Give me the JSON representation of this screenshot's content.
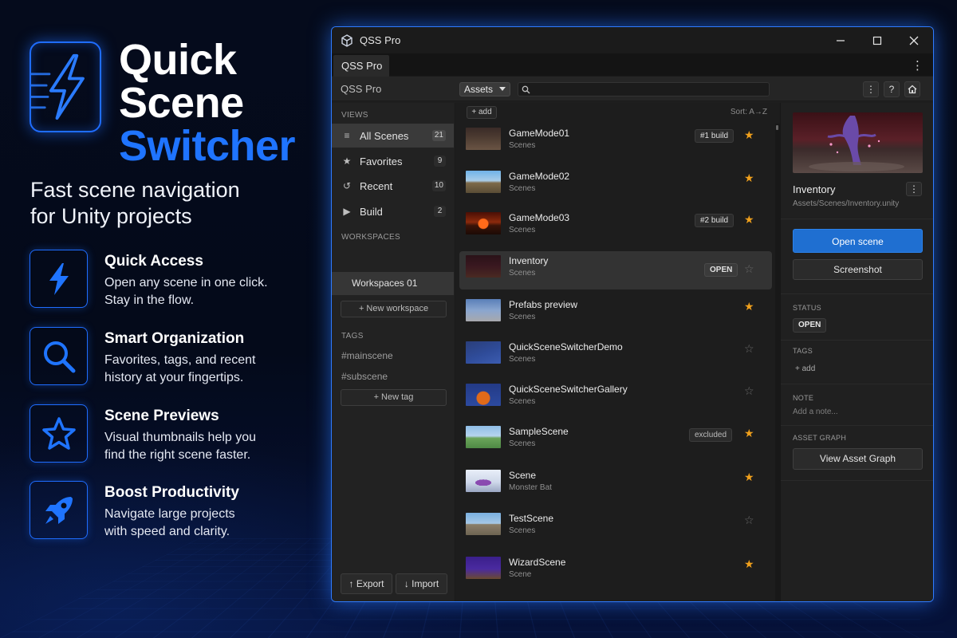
{
  "hero": {
    "title_line1": "Quick",
    "title_line2": "Scene",
    "title_line3": "Switcher",
    "tagline_line1": "Fast scene navigation",
    "tagline_line2": "for Unity projects",
    "accent_color": "#1f74ff"
  },
  "features": [
    {
      "icon": "lightning-icon",
      "title": "Quick Access",
      "desc_line1": "Open any scene in one click.",
      "desc_line2": "Stay in the flow."
    },
    {
      "icon": "search-icon",
      "title": "Smart Organization",
      "desc_line1": "Favorites, tags, and recent",
      "desc_line2": "history at your fingertips."
    },
    {
      "icon": "star-icon",
      "title": "Scene Previews",
      "desc_line1": "Visual thumbnails help you",
      "desc_line2": "find the right scene faster."
    },
    {
      "icon": "rocket-icon",
      "title": "Boost Productivity",
      "desc_line1": "Navigate large projects",
      "desc_line2": "with speed and clarity."
    }
  ],
  "window": {
    "title": "QSS Pro",
    "tab_label": "QSS Pro",
    "toolbar_title": "QSS Pro",
    "assets_select": "Assets",
    "search_value": "",
    "more_label": "⋮",
    "help_label": "?",
    "home_label": "⌂"
  },
  "sidebar": {
    "views_label": "VIEWS",
    "views": [
      {
        "icon": "list-icon",
        "label": "All Scenes",
        "count": "21"
      },
      {
        "icon": "star-icon",
        "label": "Favorites",
        "count": "9"
      },
      {
        "icon": "recent-icon",
        "label": "Recent",
        "count": "10"
      },
      {
        "icon": "play-icon",
        "label": "Build",
        "count": "2"
      }
    ],
    "workspaces_label": "WORKSPACES",
    "workspace_item": "Workspaces 01",
    "new_workspace": "+ New workspace",
    "tags_label": "TAGS",
    "tags": [
      "#mainscene",
      "#subscene"
    ],
    "new_tag": "+ New tag",
    "export_label": "↑ Export",
    "import_label": "↓ Import"
  },
  "list": {
    "add_label": "+ add",
    "sort_label": "Sort: A→Z",
    "scenes": [
      {
        "name": "GameMode01",
        "path": "Scenes",
        "badge": "#1 build",
        "starred": true
      },
      {
        "name": "GameMode02",
        "path": "Scenes",
        "badge": "",
        "starred": true
      },
      {
        "name": "GameMode03",
        "path": "Scenes",
        "badge": "#2 build",
        "starred": true
      },
      {
        "name": "Inventory",
        "path": "Scenes",
        "badge": "OPEN",
        "starred": false,
        "selected": true
      },
      {
        "name": "Prefabs preview",
        "path": "Scenes",
        "badge": "",
        "starred": true
      },
      {
        "name": "QuickSceneSwitcherDemo",
        "path": "Scenes",
        "badge": "",
        "starred": false
      },
      {
        "name": "QuickSceneSwitcherGallery",
        "path": "Scenes",
        "badge": "",
        "starred": false
      },
      {
        "name": "SampleScene",
        "path": "Scenes",
        "badge": "excluded",
        "starred": true
      },
      {
        "name": "Scene",
        "path": "Monster Bat",
        "badge": "",
        "starred": true
      },
      {
        "name": "TestScene",
        "path": "Scenes",
        "badge": "",
        "starred": false
      },
      {
        "name": "WizardScene",
        "path": "Scene",
        "badge": "",
        "starred": true
      }
    ],
    "star_on": "★",
    "star_off": "☆"
  },
  "detail": {
    "name": "Inventory",
    "path": "Assets/Scenes/Inventory.unity",
    "menu_label": "⋮",
    "open_button": "Open scene",
    "screenshot_button": "Screenshot",
    "status_label": "STATUS",
    "status_value": "OPEN",
    "tags_label": "TAGS",
    "tags_add": "+ add",
    "note_label": "NOTE",
    "note_placeholder": "Add a note...",
    "graph_label": "ASSET GRAPH",
    "graph_button": "View Asset Graph"
  }
}
